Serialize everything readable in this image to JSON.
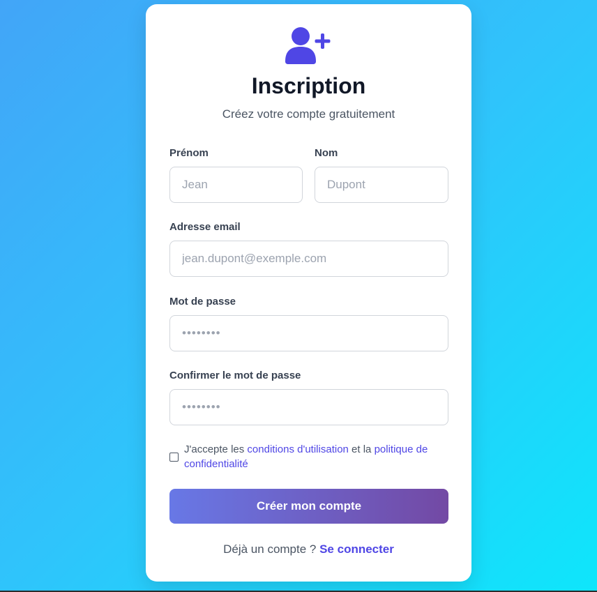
{
  "header": {
    "icon": "user-plus-icon",
    "title": "Inscription",
    "subtitle": "Créez votre compte gratuitement"
  },
  "form": {
    "first_name": {
      "label": "Prénom",
      "placeholder": "Jean",
      "value": ""
    },
    "last_name": {
      "label": "Nom",
      "placeholder": "Dupont",
      "value": ""
    },
    "email": {
      "label": "Adresse email",
      "placeholder": "jean.dupont@exemple.com",
      "value": ""
    },
    "password": {
      "label": "Mot de passe",
      "placeholder": "••••••••",
      "value": ""
    },
    "confirm_password": {
      "label": "Confirmer le mot de passe",
      "placeholder": "••••••••",
      "value": ""
    },
    "terms": {
      "checked": false,
      "text_before": "J'accepte les ",
      "link_conditions": "conditions d'utilisation",
      "text_middle": " et la ",
      "link_privacy": "politique de confidentialité"
    },
    "submit_label": "Créer mon compte"
  },
  "footer": {
    "text": "Déjà un compte ? ",
    "link_label": "Se connecter"
  },
  "colors": {
    "accent": "#4f46e5",
    "button_gradient_start": "#6878e6",
    "button_gradient_end": "#7349a4",
    "background_start": "#42a5f8",
    "background_end": "#0ee6fb"
  }
}
